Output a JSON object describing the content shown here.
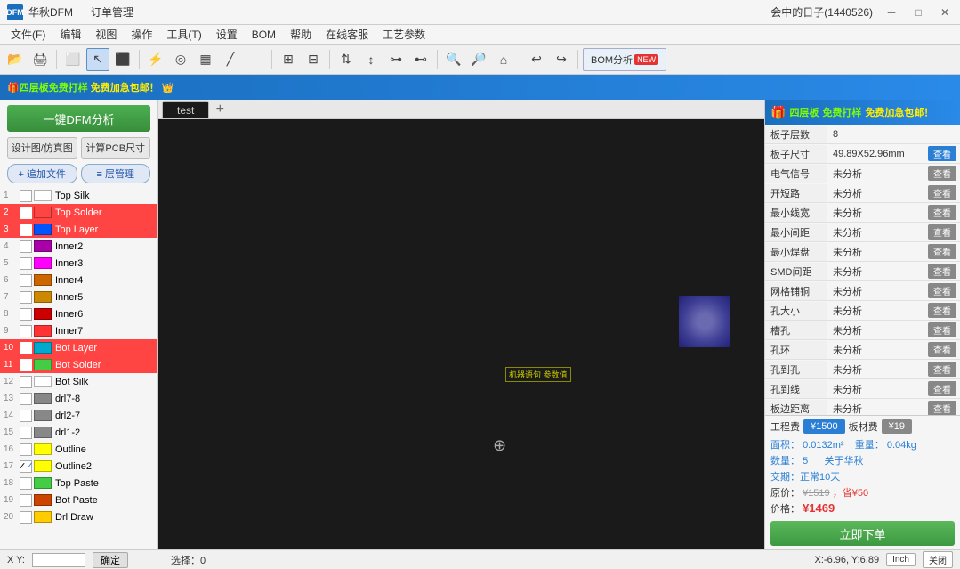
{
  "titlebar": {
    "logo": "DFM",
    "app_name": "华秋DFM",
    "tab1": "订单管理",
    "user": "会中的日子(1440526)",
    "min_btn": "─",
    "max_btn": "□",
    "close_btn": "✕"
  },
  "menubar": {
    "items": [
      "文件(F)",
      "编辑",
      "视图",
      "操作",
      "工具(T)",
      "设置",
      "BOM",
      "帮助",
      "在线客服",
      "工艺参数"
    ]
  },
  "toolbar": {
    "bom_label": "BOM分析",
    "bom_new": "NEW"
  },
  "banner": {
    "text1": "四层板",
    "text2": "免费打样",
    "text3": "免费加急包邮！",
    "suffix": "🎁"
  },
  "leftpanel": {
    "dfm_btn": "一键DFM分析",
    "sub_btn1": "设计图/仿真图",
    "sub_btn2": "计算PCB尺寸",
    "add_file_btn": "+ 追加文件",
    "layer_mgr_btn": "≡ 层管理",
    "layers": [
      {
        "num": "1",
        "checked": false,
        "color": "#ffffff",
        "name": "Top Silk"
      },
      {
        "num": "2",
        "checked": false,
        "color": "#ff4444",
        "name": "Top Solder"
      },
      {
        "num": "3",
        "checked": false,
        "color": "#0055ff",
        "name": "Top Layer"
      },
      {
        "num": "4",
        "checked": false,
        "color": "#aa00aa",
        "name": "Inner2"
      },
      {
        "num": "5",
        "checked": false,
        "color": "#ff00ff",
        "name": "Inner3"
      },
      {
        "num": "6",
        "checked": false,
        "color": "#cc6600",
        "name": "Inner4"
      },
      {
        "num": "7",
        "checked": false,
        "color": "#cc8800",
        "name": "Inner5"
      },
      {
        "num": "8",
        "checked": false,
        "color": "#cc0000",
        "name": "Inner6"
      },
      {
        "num": "9",
        "checked": false,
        "color": "#ff3333",
        "name": "Inner7"
      },
      {
        "num": "10",
        "checked": false,
        "color": "#00aacc",
        "name": "Bot Layer"
      },
      {
        "num": "11",
        "checked": false,
        "color": "#44cc44",
        "name": "Bot Solder"
      },
      {
        "num": "12",
        "checked": false,
        "color": "#ffffff",
        "name": "Bot Silk"
      },
      {
        "num": "13",
        "checked": false,
        "color": "#888888",
        "name": "drl7-8"
      },
      {
        "num": "14",
        "checked": false,
        "color": "#888888",
        "name": "drl2-7"
      },
      {
        "num": "15",
        "checked": false,
        "color": "#888888",
        "name": "drl1-2"
      },
      {
        "num": "16",
        "checked": false,
        "color": "#ffff00",
        "name": "Outline"
      },
      {
        "num": "17",
        "checked": true,
        "color": "#ffff00",
        "name": "Outline2"
      },
      {
        "num": "18",
        "checked": false,
        "color": "#44cc44",
        "name": "Top Paste"
      },
      {
        "num": "19",
        "checked": false,
        "color": "#cc4400",
        "name": "Bot Paste"
      },
      {
        "num": "20",
        "checked": false,
        "color": "#ffcc00",
        "name": "Drl Draw"
      }
    ]
  },
  "tabs": {
    "active": "test",
    "items": [
      "test"
    ],
    "add_label": "+"
  },
  "canvas": {
    "pcb_label": "机器语句 参数值",
    "crosshair": "⊕"
  },
  "rightpanel": {
    "banner_text1": "四层板",
    "banner_text2": "免费打样",
    "banner_text3": "免费加急包邮！",
    "rows": [
      {
        "label": "板子层数",
        "value": "8",
        "has_btn": false
      },
      {
        "label": "板子尺寸",
        "value": "49.89X52.96mm",
        "has_btn": true,
        "btn": "查看"
      },
      {
        "label": "电气信号",
        "value": "未分析",
        "has_btn": true,
        "btn": "查看"
      },
      {
        "label": "开短路",
        "value": "未分析",
        "has_btn": true,
        "btn": "查看"
      },
      {
        "label": "最小线宽",
        "value": "未分析",
        "has_btn": true,
        "btn": "查看"
      },
      {
        "label": "最小间距",
        "value": "未分析",
        "has_btn": true,
        "btn": "查看"
      },
      {
        "label": "最小焊盘",
        "value": "未分析",
        "has_btn": true,
        "btn": "查看"
      },
      {
        "label": "SMD间距",
        "value": "未分析",
        "has_btn": true,
        "btn": "查看"
      },
      {
        "label": "网格铺铜",
        "value": "未分析",
        "has_btn": true,
        "btn": "查看"
      },
      {
        "label": "孔大小",
        "value": "未分析",
        "has_btn": true,
        "btn": "查看"
      },
      {
        "label": "槽孔",
        "value": "未分析",
        "has_btn": true,
        "btn": "查看"
      },
      {
        "label": "孔环",
        "value": "未分析",
        "has_btn": true,
        "btn": "查看"
      },
      {
        "label": "孔到孔",
        "value": "未分析",
        "has_btn": true,
        "btn": "查看"
      },
      {
        "label": "孔到线",
        "value": "未分析",
        "has_btn": true,
        "btn": "查看"
      },
      {
        "label": "板边距离",
        "value": "未分析",
        "has_btn": true,
        "btn": "查看"
      }
    ],
    "fee_label": "工程费",
    "fee_value": "¥1500",
    "material_label": "板材费",
    "material_value": "¥19",
    "area_label": "面积：",
    "area_value": "0.0132m²",
    "weight_label": "重量：",
    "weight_value": "0.04kg",
    "count_label": "数量：",
    "count_value": "5",
    "huaqiu_link": "关于华秋",
    "delivery_label": "交期：正常10天",
    "price_original_label": "原价：",
    "price_original": "¥1519",
    "price_discount": "，省¥50",
    "price_final_label": "价格：",
    "price_final": "¥1469",
    "order_btn": "立即下单"
  },
  "bottombar": {
    "xy_label": "X Y:",
    "input_placeholder": "",
    "confirm_btn": "确定",
    "status": "选择：0",
    "coords": "X:-6.96, Y:6.89",
    "unit": "Inch",
    "close": "关闭"
  }
}
